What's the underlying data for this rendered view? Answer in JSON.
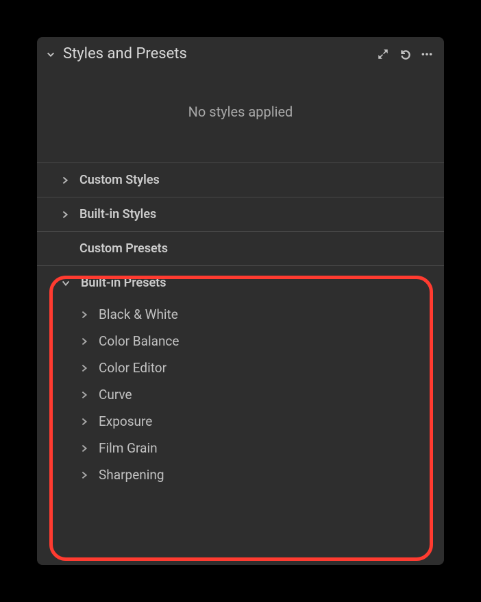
{
  "panel": {
    "title": "Styles and Presets",
    "empty_message": "No styles applied"
  },
  "sections": {
    "custom_styles": "Custom Styles",
    "builtin_styles": "Built-in Styles",
    "custom_presets": "Custom Presets",
    "builtin_presets": "Built-in Presets"
  },
  "builtin_presets_items": [
    "Black & White",
    "Color Balance",
    "Color Editor",
    "Curve",
    "Exposure",
    "Film Grain",
    "Sharpening"
  ]
}
